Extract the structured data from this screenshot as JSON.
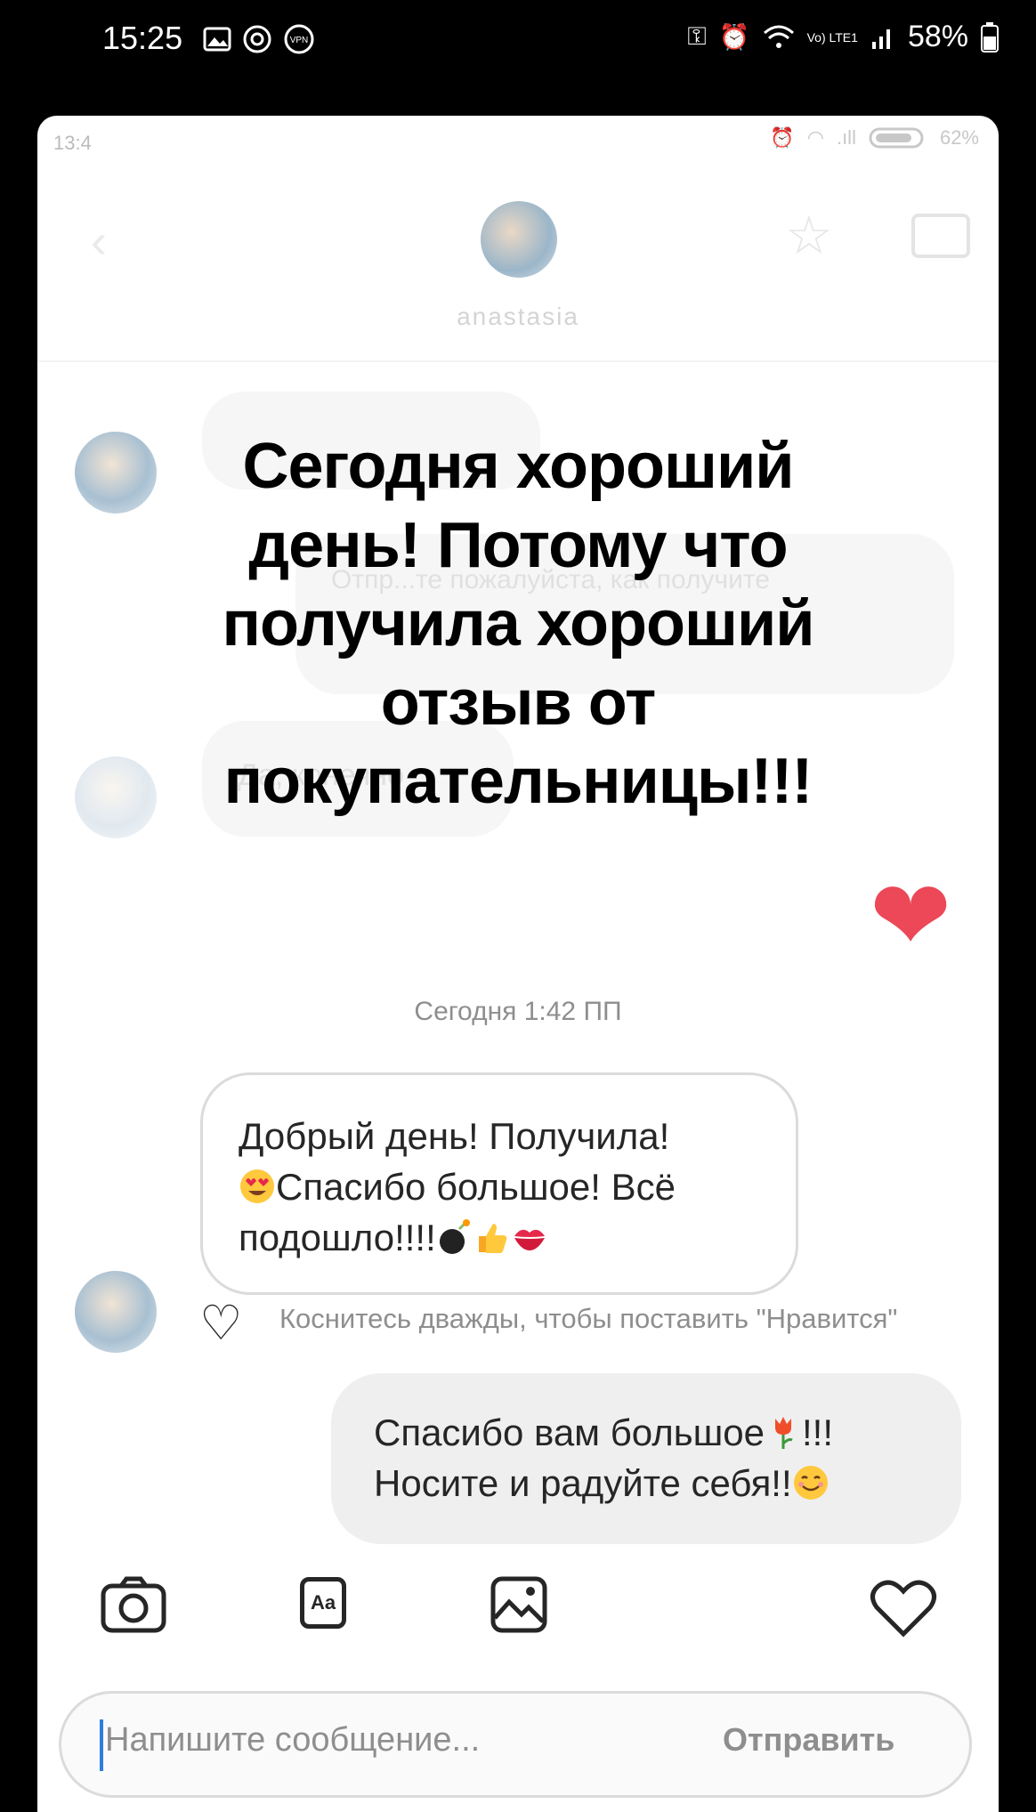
{
  "phone_status": {
    "time": "15:25",
    "battery": "58%",
    "vpn_label": "VPN",
    "lte_label": "Vo) LTE1"
  },
  "inner_status": {
    "time": "13:4",
    "battery": "62%"
  },
  "header": {
    "name": "anastasia"
  },
  "faded": {
    "bubble_1": "",
    "bubble_2": "Отпр...те пожалуйста, как получите",
    "bubble_3": "Да, конечно"
  },
  "overlay_title": "Сегодня хороший день! Потому что получила хороший отзыв от покупательницы!!!",
  "date_separator": "Сегодня 1:42 ПП",
  "incoming": {
    "line1": "Добрый день! Получила!",
    "line2": "Спасибо большое! Всё",
    "line3": "подошло!!!!"
  },
  "like_hint": "Коснитесь дважды, чтобы поставить \"Нравится\"",
  "outgoing": {
    "line1": "Спасибо вам большое",
    "line1_suffix": "!!!",
    "line2": "Носите и радуйте себя!!"
  },
  "composer": {
    "placeholder": "Напишите сообщение...",
    "send_label": "Отправить",
    "aa_label": "Aa"
  },
  "colors": {
    "heart": "#e9293a",
    "caret": "#2d7de0"
  }
}
